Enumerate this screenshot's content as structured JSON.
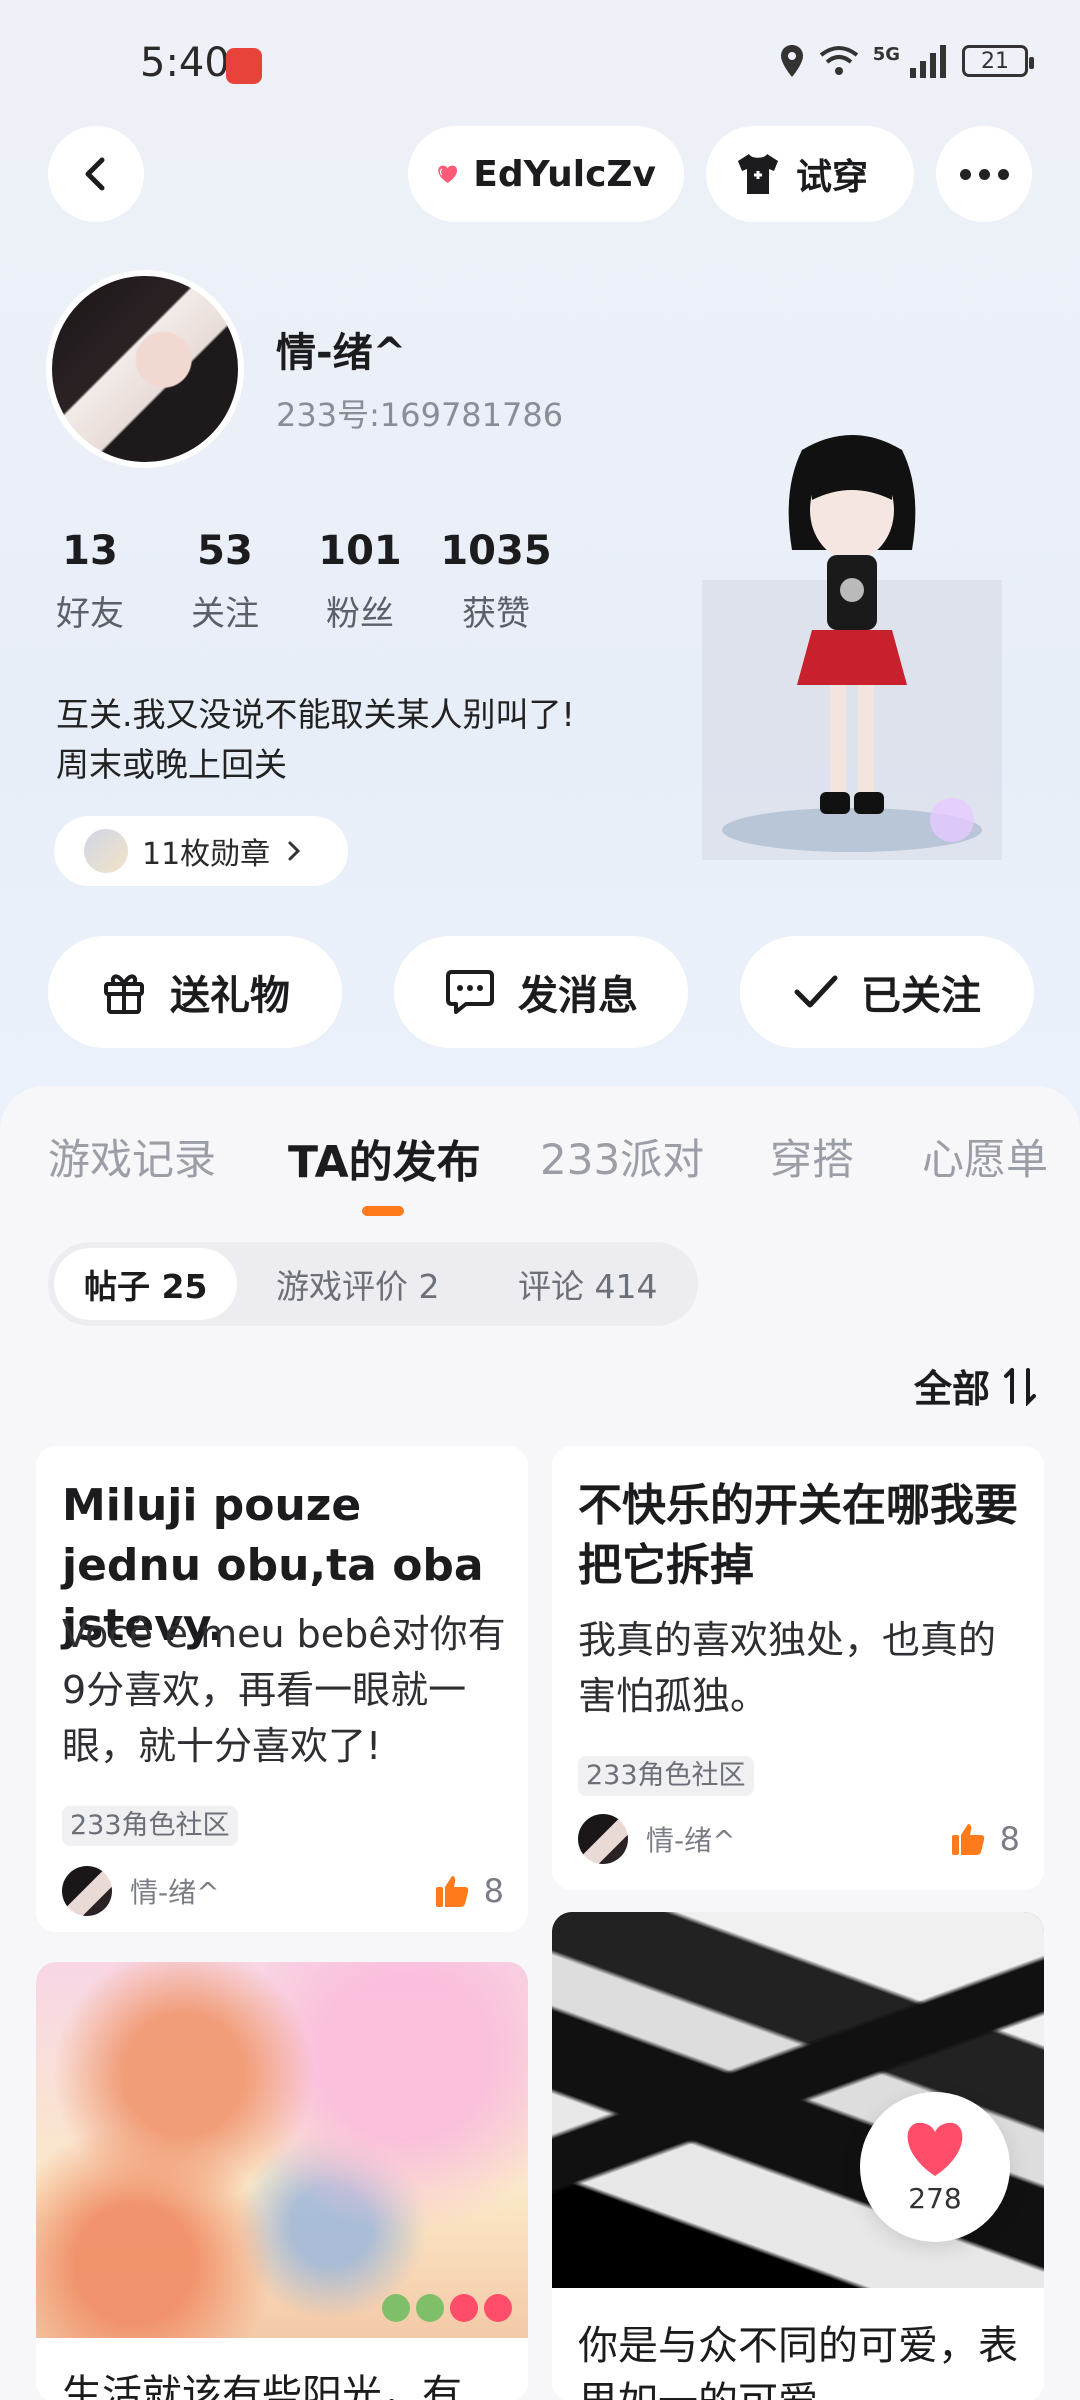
{
  "status_bar": {
    "time": "5:40",
    "network": "5G",
    "battery": "21"
  },
  "top_nav": {
    "name_label": "EdYulcZv",
    "try_label": "试穿"
  },
  "profile": {
    "nickname": "情-绪^",
    "user_id": "233号:169781786",
    "stats": [
      {
        "num": "13",
        "label": "好友"
      },
      {
        "num": "53",
        "label": "关注"
      },
      {
        "num": "101",
        "label": "粉丝"
      },
      {
        "num": "1035",
        "label": "获赞"
      }
    ],
    "bio_line1": "互关.我又没说不能取关某人别叫了!",
    "bio_line2": "周末或晚上回关",
    "badges": "11枚勋章"
  },
  "actions": {
    "gift": "送礼物",
    "message": "发消息",
    "follow": "已关注"
  },
  "tabs": [
    "游戏记录",
    "TA的发布",
    "233派对",
    "穿搭",
    "心愿单"
  ],
  "subtabs": [
    "帖子 25",
    "游戏评价 2",
    "评论 414"
  ],
  "sort_label": "全部",
  "posts": [
    {
      "title": "Miluji pouze jednu obu,ta oba jstevy.",
      "body": "Você é meu bebê对你有9分喜欢，再看一眼就一眼，就十分喜欢了!",
      "tag": "233角色社区",
      "author": "情-绪^",
      "likes": "8"
    },
    {
      "title": "不快乐的开关在哪我要把它拆掉",
      "body": "我真的喜欢独处，也真的害怕孤独。",
      "tag": "233角色社区",
      "author": "情-绪^",
      "likes": "8"
    },
    {
      "text": "生活就该有些阳光，有"
    },
    {
      "text": "你是与众不同的可爱，表里如一的可爱"
    }
  ],
  "like_bubble": {
    "count": "278"
  },
  "colors": {
    "accent": "#ff7a1a",
    "heart": "#ff4d6a"
  }
}
